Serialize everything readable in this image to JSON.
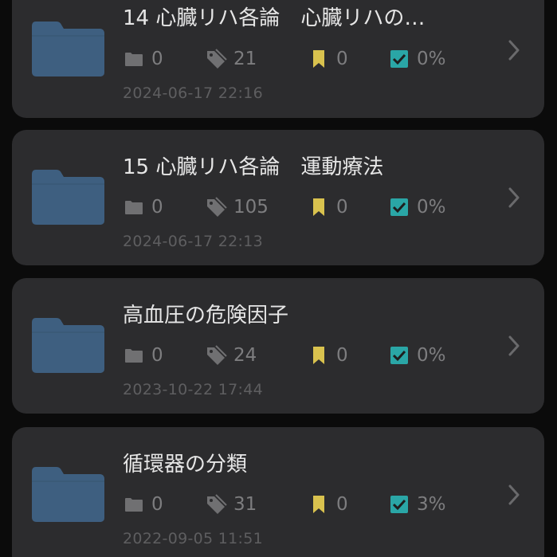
{
  "colors": {
    "background": "#0b0b0b",
    "card": "#2c2c2e",
    "folder": "#3e5f80",
    "title_text": "#e6e6e6",
    "stat_text": "#7d7d7f",
    "date_text": "#5e5e60",
    "bookmark": "#d9c24e",
    "check": "#2aa6a6"
  },
  "icons": {
    "folder": "folder-icon",
    "sub_folders": "folder-small-icon",
    "tags": "tag-icon",
    "bookmarks": "bookmark-icon",
    "done": "checkbox-checked-icon",
    "chevron": "chevron-right-icon"
  },
  "items": [
    {
      "title": "14 心臓リハ各論　心臓リハの…",
      "folders": "0",
      "tags": "21",
      "bookmarks": "0",
      "progress": "0%",
      "date": "2024-06-17 22:16"
    },
    {
      "title": "15 心臓リハ各論　運動療法",
      "folders": "0",
      "tags": "105",
      "bookmarks": "0",
      "progress": "0%",
      "date": "2024-06-17 22:13"
    },
    {
      "title": "高血圧の危険因子",
      "folders": "0",
      "tags": "24",
      "bookmarks": "0",
      "progress": "0%",
      "date": "2023-10-22 17:44"
    },
    {
      "title": "循環器の分類",
      "folders": "0",
      "tags": "31",
      "bookmarks": "0",
      "progress": "3%",
      "date": "2022-09-05 11:51"
    }
  ]
}
